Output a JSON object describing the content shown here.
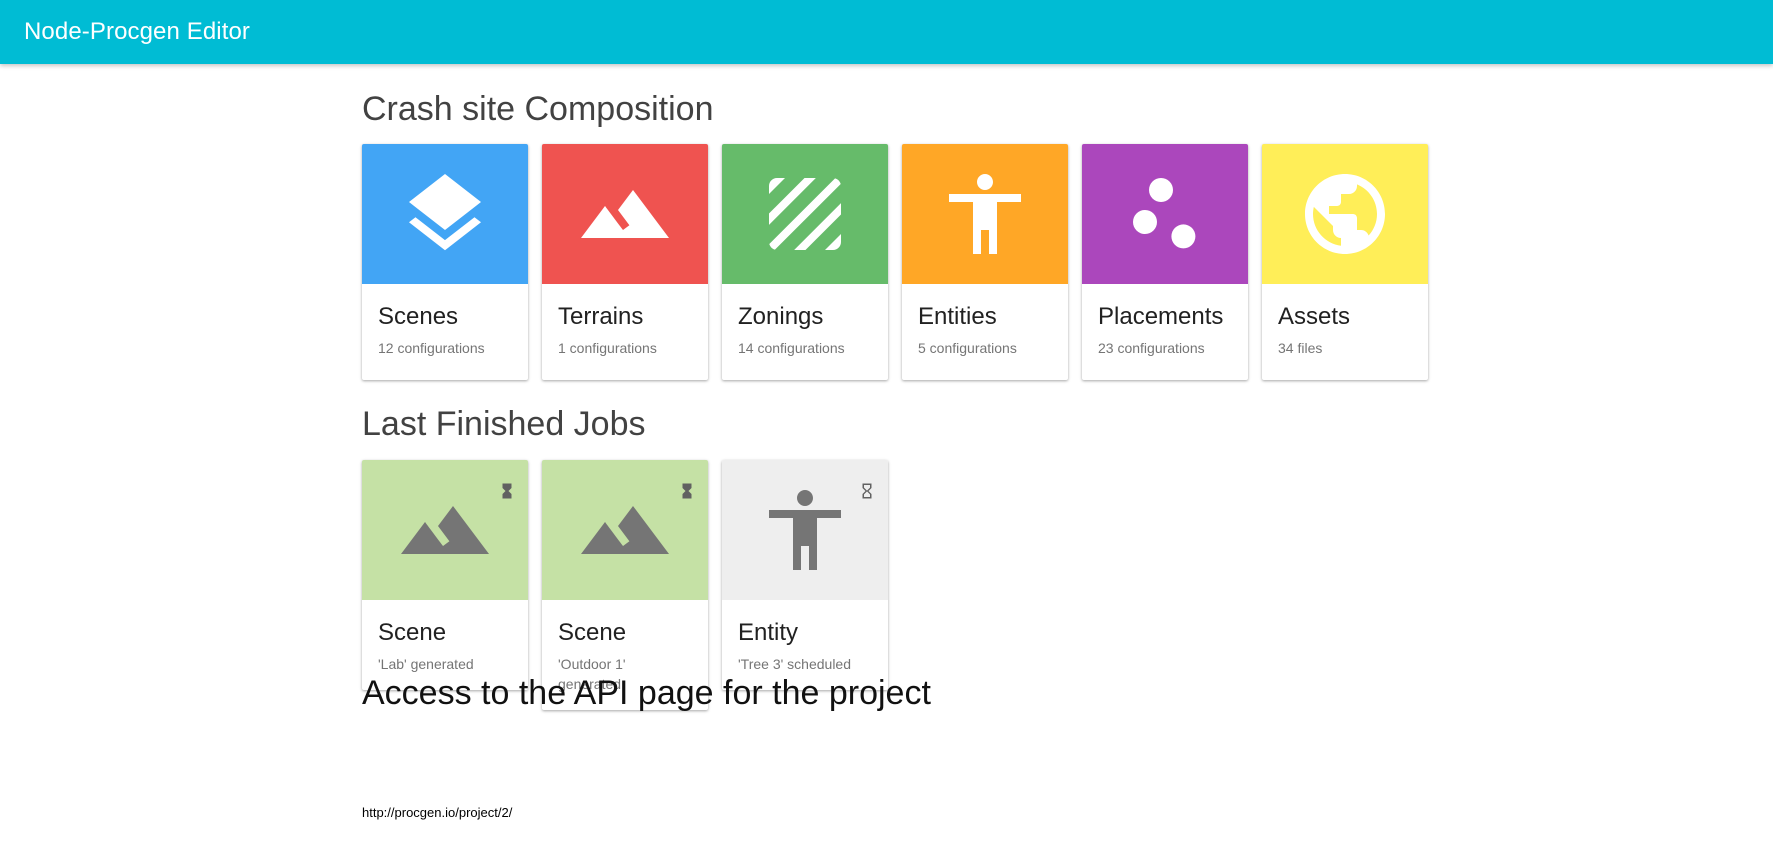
{
  "app": {
    "title": "Node-Procgen Editor"
  },
  "composition": {
    "title": "Crash site Composition",
    "cards": [
      {
        "title": "Scenes",
        "subtitle": "12 configurations",
        "icon": "layers-icon",
        "color": "#42a5f5"
      },
      {
        "title": "Terrains",
        "subtitle": "1 configurations",
        "icon": "terrain-icon",
        "color": "#ef5350"
      },
      {
        "title": "Zonings",
        "subtitle": "14 configurations",
        "icon": "texture-icon",
        "color": "#66bb6a"
      },
      {
        "title": "Entities",
        "subtitle": "5 configurations",
        "icon": "accessibility-icon",
        "color": "#ffa726"
      },
      {
        "title": "Placements",
        "subtitle": "23 configurations",
        "icon": "scatter-icon",
        "color": "#ab47bc"
      },
      {
        "title": "Assets",
        "subtitle": "34 files",
        "icon": "globe-icon",
        "color": "#ffee58"
      }
    ]
  },
  "jobs": {
    "title": "Last Finished Jobs",
    "cards": [
      {
        "title": "Scene",
        "subtitle": "'Lab' generated",
        "icon": "terrain-icon",
        "status_icon": "hourglass-full-icon",
        "color": "#c5e1a5"
      },
      {
        "title": "Scene",
        "subtitle": "'Outdoor 1' generated",
        "icon": "terrain-icon",
        "status_icon": "hourglass-full-icon",
        "color": "#c5e1a5"
      },
      {
        "title": "Entity",
        "subtitle": "'Tree 3' scheduled",
        "icon": "accessibility-icon",
        "status_icon": "hourglass-empty-icon",
        "color": "#eeeeee"
      }
    ]
  },
  "api": {
    "title": "Access to the API page for the project",
    "url": "http://procgen.io/project/2/"
  }
}
